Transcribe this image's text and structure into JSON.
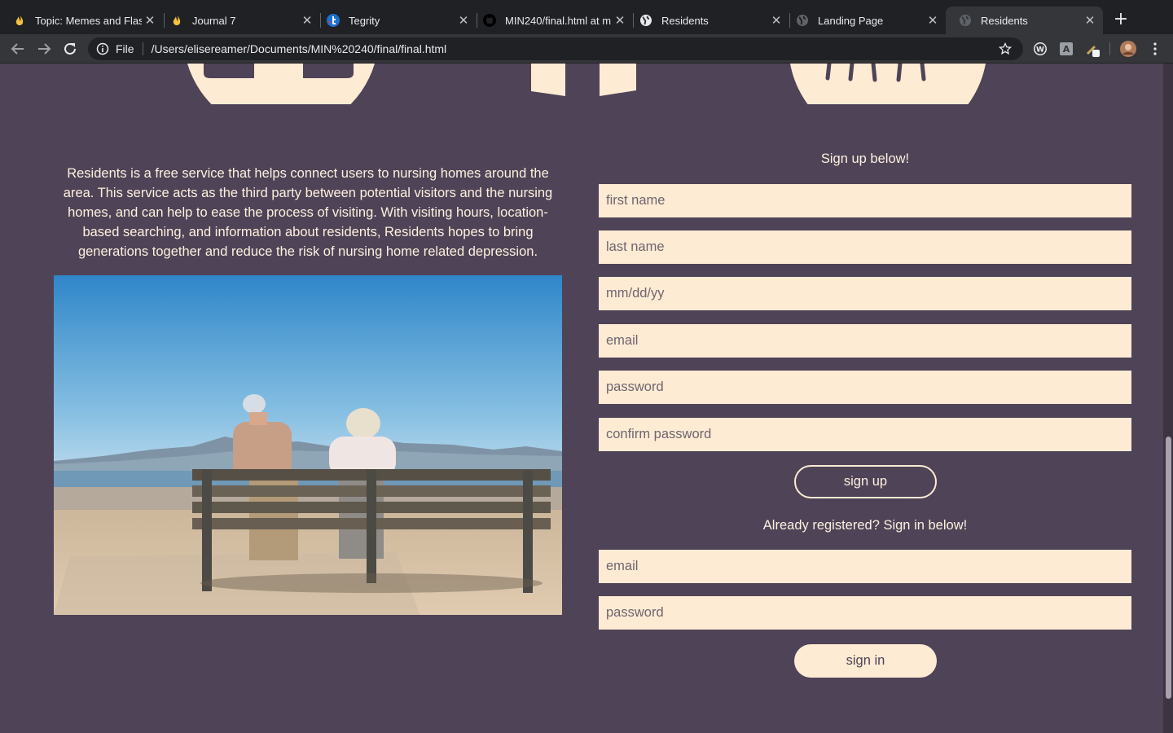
{
  "browser": {
    "tabs": [
      {
        "title": "Topic: Memes and Flas",
        "icon": "flame-icon",
        "active": false
      },
      {
        "title": "Journal 7",
        "icon": "flame-icon",
        "active": false
      },
      {
        "title": "Tegrity",
        "icon": "tegrity-icon",
        "active": false
      },
      {
        "title": "MIN240/final.html at m",
        "icon": "github-icon",
        "active": false
      },
      {
        "title": "Residents",
        "icon": "globe-icon",
        "active": false
      },
      {
        "title": "Landing Page",
        "icon": "globe-icon",
        "active": false
      },
      {
        "title": "Residents",
        "icon": "globe-icon",
        "active": true
      }
    ],
    "new_tab_label": "+",
    "address": {
      "scheme_label": "File",
      "url": "/Users/elisereamer/Documents/MIN%20240/final/final.html"
    },
    "extension_labels": {
      "w_ext": "W",
      "translate_ext": "A"
    }
  },
  "page": {
    "about_text": "Residents is a free service that helps connect users to nursing homes around the area. This service acts as the third party between potential visitors and the nursing homes, and can help to ease the process of visiting. With visiting hours, location-based searching, and information about residents, Residents hopes to bring generations together and reduce the risk of nursing home related depression.",
    "photo_alt": "Elderly couple sitting on a bench by the sea",
    "signup": {
      "heading": "Sign up below!",
      "fields": {
        "first_name": "first name",
        "last_name": "last name",
        "dob": "mm/dd/yy",
        "email": "email",
        "password": "password",
        "confirm_password": "confirm password"
      },
      "button": "sign up"
    },
    "signin": {
      "heading": "Already registered? Sign in below!",
      "fields": {
        "email": "email",
        "password": "password"
      },
      "button": "sign in"
    },
    "colors": {
      "background": "#4f4357",
      "cream": "#fdebd3",
      "chrome_dark": "#202124",
      "chrome_toolbar": "#35363a"
    }
  }
}
